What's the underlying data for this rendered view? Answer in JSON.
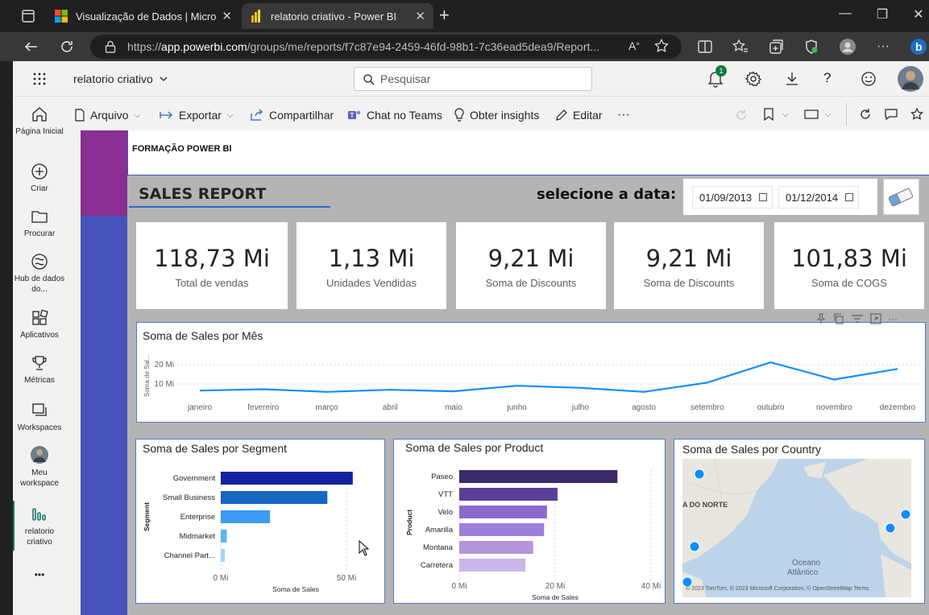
{
  "browser": {
    "tabs": [
      {
        "title": "Visualização de Dados | Microsoft",
        "close": "✕"
      },
      {
        "title": "relatorio criativo - Power BI",
        "close": "✕"
      }
    ],
    "new_tab": "+",
    "url_prefix": "https://",
    "url_host": "app.powerbi.com",
    "url_path": "/groups/me/reports/f7c87e94-2459-46fd-98b1-7c36ead5dea9/Report...",
    "window_controls": {
      "minimize": "—",
      "maximize": "❐",
      "close": "✕"
    }
  },
  "app": {
    "report_name": "relatorio criativo",
    "search_placeholder": "Pesquisar",
    "notification_count": "1"
  },
  "rail": [
    {
      "label": "Página Inicial",
      "icon": "home-icon"
    },
    {
      "label": "Criar",
      "icon": "plus-circle-icon"
    },
    {
      "label": "Procurar",
      "icon": "folder-icon"
    },
    {
      "label": "Hub de dados do...",
      "icon": "data-hub-icon"
    },
    {
      "label": "Aplicativos",
      "icon": "apps-icon"
    },
    {
      "label": "Métricas",
      "icon": "trophy-icon"
    },
    {
      "label": "Workspaces",
      "icon": "workspaces-icon"
    },
    {
      "label": "Meu workspace",
      "icon": "avatar"
    },
    {
      "label": "relatorio criativo",
      "icon": "report-icon"
    }
  ],
  "rail_more": "•••",
  "actions": {
    "arquivo": "Arquivo",
    "exportar": "Exportar",
    "compartilhar": "Compartilhar",
    "chat_teams": "Chat no Teams",
    "insights": "Obter insights",
    "editar": "Editar",
    "more": "···"
  },
  "report": {
    "brand": "FORMAÇÃO POWER BI",
    "title": "SALES REPORT",
    "date_label": "selecione a data:",
    "date_start": "01/09/2013",
    "date_end": "01/12/2014"
  },
  "cards": [
    {
      "value": "118,73 Mi",
      "label": "Total de vendas"
    },
    {
      "value": "1,13 Mi",
      "label": "Unidades Vendidas"
    },
    {
      "value": "9,21 Mi",
      "label": "Soma de Discounts"
    },
    {
      "value": "9,21 Mi",
      "label": "Soma de Discounts"
    },
    {
      "value": "101,83 Mi",
      "label": "Soma de COGS"
    }
  ],
  "colors": {
    "accent_purple": "#8b2e91",
    "accent_blue": "#4653b8",
    "line": "#118dff",
    "segment_bars": [
      "#12239e",
      "#1665c1",
      "#3b9bf2",
      "#5cb5f5",
      "#a0d3fb"
    ],
    "product_bars": [
      "#3b2a6b",
      "#5a3f9a",
      "#8a6ccd",
      "#9c7fd8",
      "#b596da",
      "#cbb6ea"
    ]
  },
  "chart_data": [
    {
      "type": "line",
      "title": "Soma de Sales por Mês",
      "ylabel": "Soma de Sal...",
      "x": [
        "janeiro",
        "fevereiro",
        "março",
        "abril",
        "maio",
        "junho",
        "julho",
        "agosto",
        "setembro",
        "outubro",
        "novembro",
        "dezembro"
      ],
      "values": [
        6.6,
        7.3,
        5.9,
        7.0,
        6.2,
        9.1,
        8.0,
        5.9,
        10.7,
        21.2,
        12.3,
        17.8
      ],
      "yticks": [
        "10 Mi",
        "20 Mi"
      ],
      "ylim": [
        0,
        25
      ],
      "grid": true
    },
    {
      "type": "bar",
      "title": "Soma de Sales por Segment",
      "xlabel": "Soma de Sales",
      "ylabel": "Segment",
      "categories": [
        "Government",
        "Small Business",
        "Enterprise",
        "Midmarket",
        "Channel Part..."
      ],
      "values": [
        52.5,
        42.4,
        19.6,
        2.4,
        1.6
      ],
      "xticks": [
        "0 Mi",
        "50 Mi"
      ],
      "xlim": [
        0,
        50
      ]
    },
    {
      "type": "bar",
      "title": "Soma de Sales por Product",
      "xlabel": "Soma de Sales",
      "ylabel": "Product",
      "categories": [
        "Paseo",
        "VTT",
        "Velo",
        "Amarilla",
        "Montana",
        "Carretera"
      ],
      "values": [
        33.0,
        20.5,
        18.3,
        17.7,
        15.4,
        13.8
      ],
      "xticks": [
        "0 Mi",
        "20 Mi",
        "40 Mi"
      ],
      "xlim": [
        0,
        40
      ]
    }
  ],
  "map": {
    "title": "Soma de Sales por Country",
    "label_region": "A DO NORTE",
    "label_ocean_1": "Oceano",
    "label_ocean_2": "Atlântico",
    "copyright": "© 2023 TomTom, © 2023 Microsoft Corporation, © OpenStreetMap  Terms",
    "bubble_color": "#118dff"
  }
}
